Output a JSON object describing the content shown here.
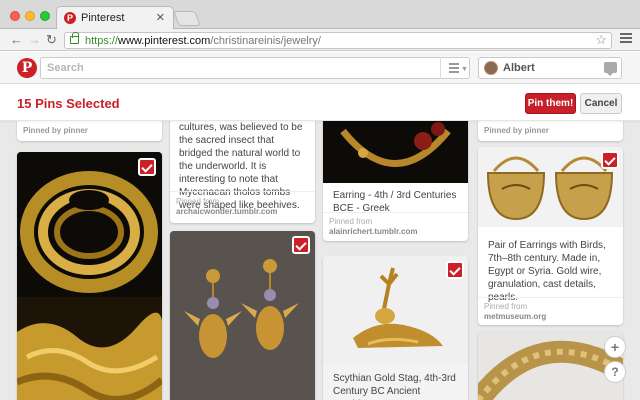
{
  "browser": {
    "tab_title": "Pinterest",
    "tab_favicon": "P",
    "url_https": "https://",
    "url_host": "www.pinterest.com",
    "url_path": "/christinareinis/jewelry/"
  },
  "header": {
    "logo": "P",
    "search_placeholder": "Search",
    "user_name": "Albert"
  },
  "selection": {
    "count_label": "15 Pins Selected",
    "pin_button": "Pin them!",
    "cancel_button": "Cancel"
  },
  "cards": [
    {
      "pinned_by": "Pinned by pinner"
    },
    {
      "description": "cultures, was believed to be the sacred insect that bridged the natural world to the underworld. It is interesting to note that Mycenaean tholos tombs were shaped like beehives.",
      "pinned_from": "Pinned from",
      "source": "archaicwonder.tumblr.com"
    },
    {
      "description": "Earring - 4th / 3rd Centuries BCE - Greek",
      "pinned_from": "Pinned from",
      "source": "alainrichert.tumblr.com"
    },
    {
      "pinned_by": "Pinned by pinner"
    },
    {
      "description": "Pair of Earrings with Birds, 7th–8th century. Made in, Egypt or Syria. Gold wire, granulation, cast details, pearls.",
      "pinned_from": "Pinned from",
      "source": "metmuseum.org"
    },
    {
      "description": "Scythian Gold Stag, 4th-3rd Century BC Ancient Scythian was"
    }
  ],
  "floating": {
    "add": "+",
    "help": "?"
  },
  "colors": {
    "brand": "#cb2027"
  }
}
